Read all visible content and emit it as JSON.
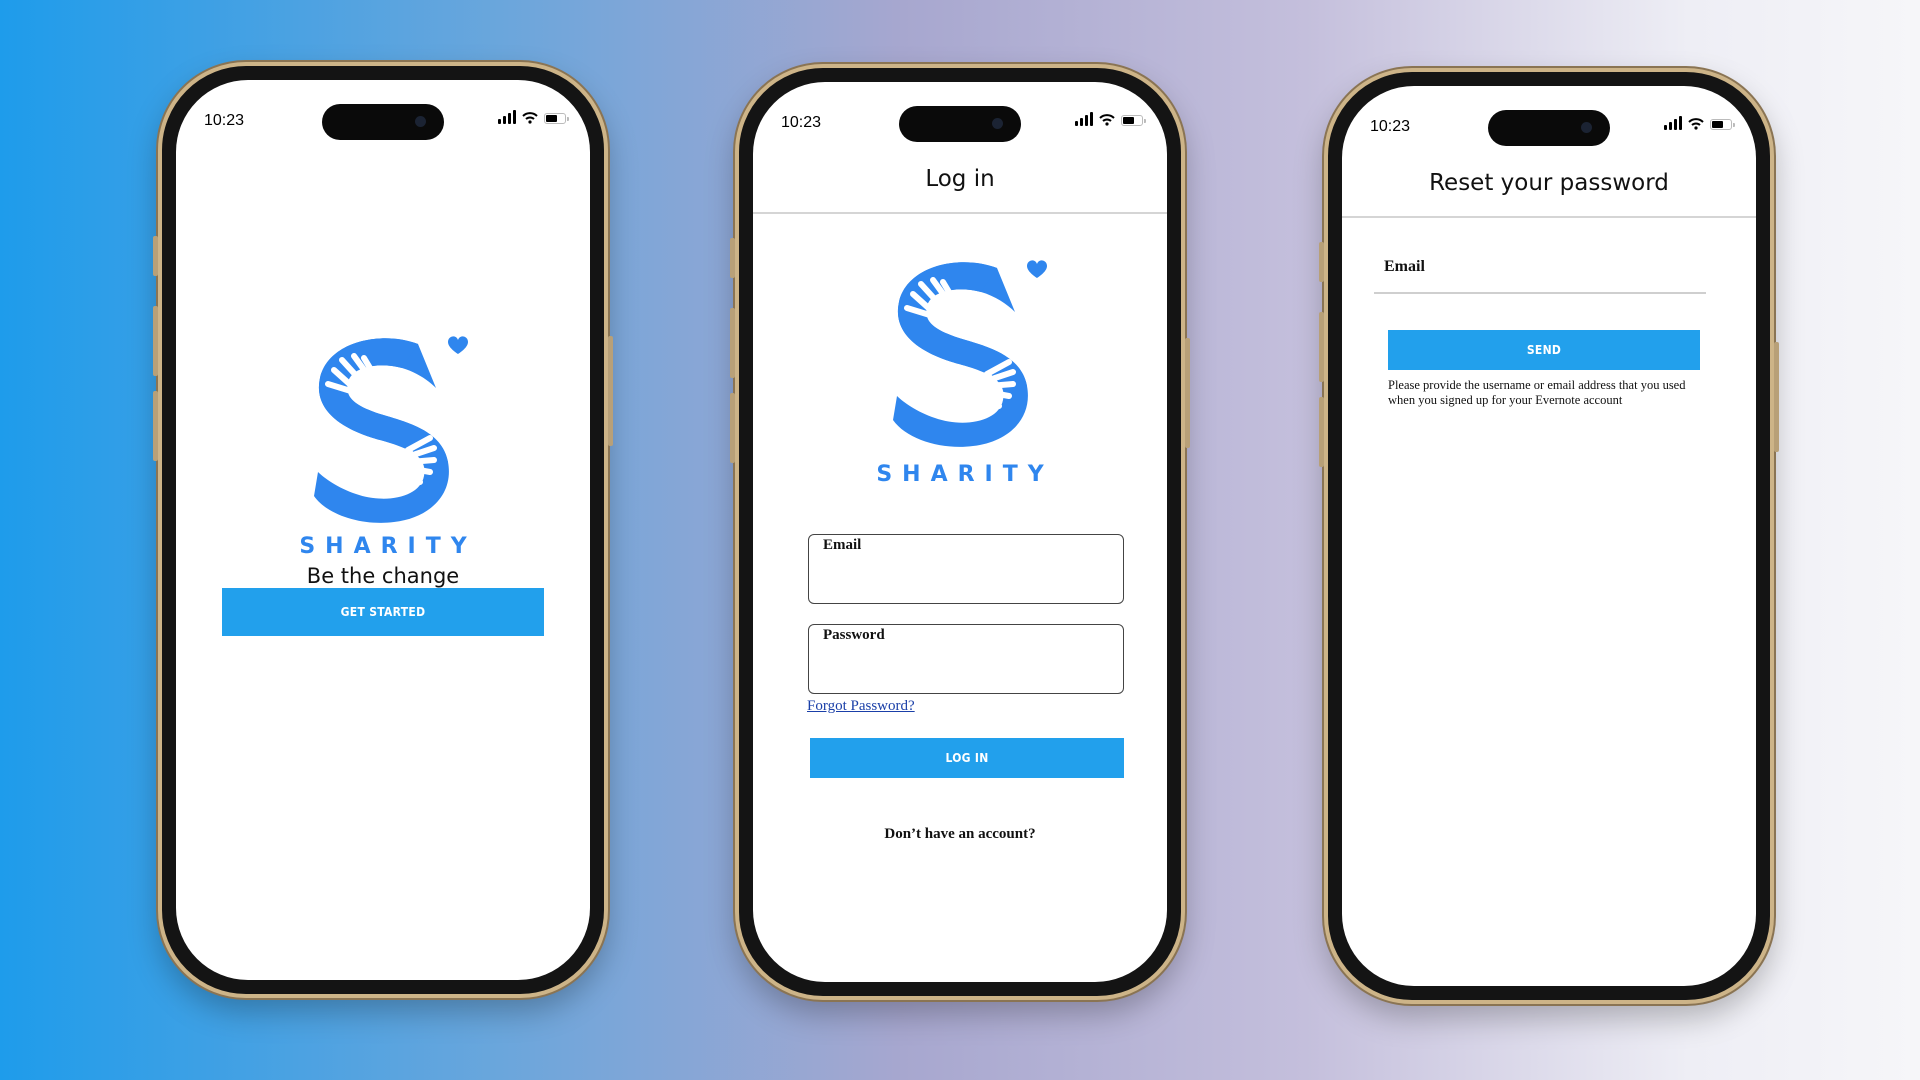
{
  "colors": {
    "accent": "#22a0ec",
    "brand": "#2f86ee",
    "link": "#1a3fa8"
  },
  "status_bar": {
    "time": "10:23"
  },
  "welcome_screen": {
    "brand_name": "SHARITY",
    "tagline": "Be the change",
    "cta_label": "GET STARTED"
  },
  "login_screen": {
    "title": "Log in",
    "brand_name": "SHARITY",
    "email_label": "Email",
    "password_label": "Password",
    "forgot_password": "Forgot Password?",
    "login_label": "LOG IN",
    "signup_prompt": "Don’t have an account?"
  },
  "reset_screen": {
    "title": "Reset your password",
    "email_label": "Email",
    "send_label": "SEND",
    "help_text": "Please provide the username or email address that you used when you signed up for your Evernote account"
  }
}
